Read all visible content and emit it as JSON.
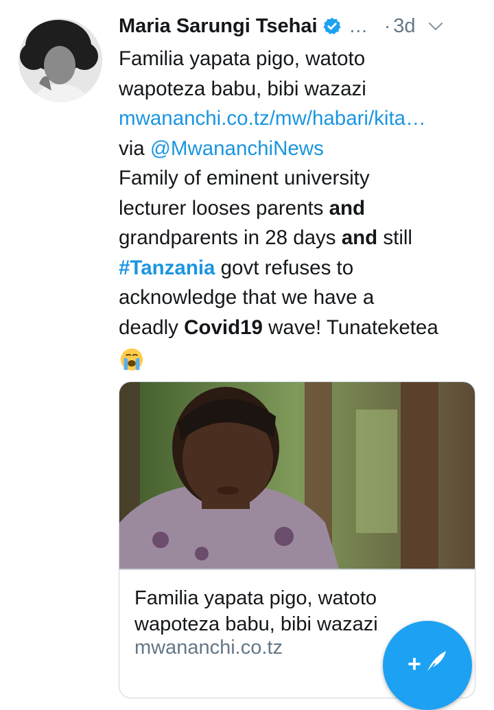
{
  "tweet": {
    "author_name": "Maria Sarungi Tsehai",
    "more_glyph": "...",
    "separator": "·",
    "timestamp": "3d",
    "lines": {
      "l1": "Familia yapata pigo, watoto",
      "l2": "wapoteza babu, bibi wazazi",
      "link": "mwananchi.co.tz/mw/habari/kita…",
      "via": "via ",
      "mention": "@MwananchiNews",
      "l5": "Family of eminent university",
      "l6a": "lecturer looses parents ",
      "l6b": "and",
      "l7a": "grandparents in 28 days ",
      "l7b": "and",
      "l7c": " still",
      "l8a": "#Tanzania",
      "l8b": " govt refuses to",
      "l9": "acknowledge that we have a",
      "l10a": "deadly ",
      "l10b": "Covid19",
      "l10c": " wave! Tunateketea"
    },
    "emoji_icon": "loudly-crying-face-emoji"
  },
  "card": {
    "title_line1": "Familia yapata pigo, watoto",
    "title_line2": "wapoteza babu, bibi wazazi",
    "domain": "mwananchi.co.tz"
  },
  "fab": {
    "plus": "+",
    "icon": "feather-icon"
  },
  "colors": {
    "link": "#1b95e0",
    "muted": "#657786",
    "fab": "#1da1f2",
    "border": "#ccd6dd"
  }
}
